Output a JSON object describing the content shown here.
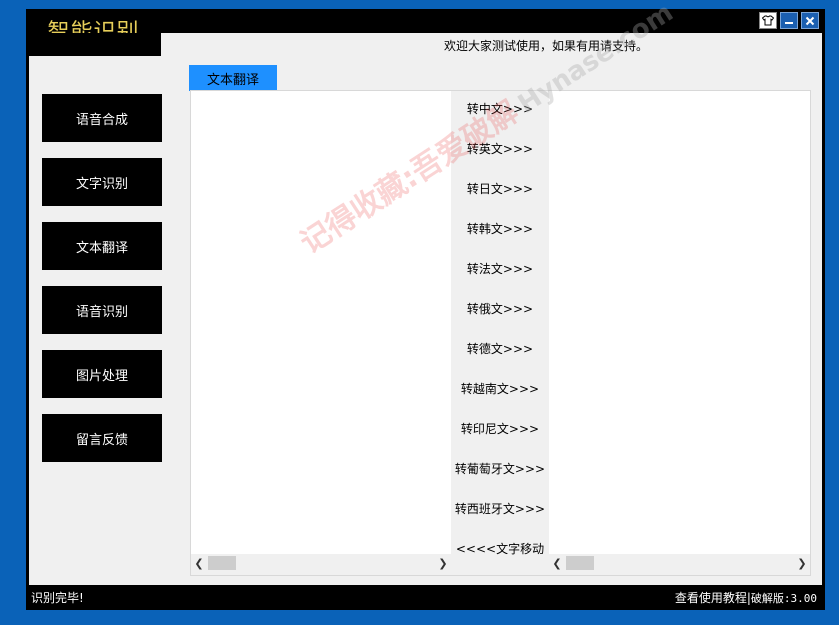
{
  "window": {
    "title": "智能识别",
    "banner": "欢迎大家测试使用，如果有用请支持。",
    "controls": {
      "skin_icon": "shirt-icon",
      "minimize_icon": "minimize-icon",
      "close_icon": "close-icon"
    }
  },
  "sidebar": {
    "items": [
      {
        "label": "语音合成"
      },
      {
        "label": "文字识别"
      },
      {
        "label": "文本翻译"
      },
      {
        "label": "语音识别"
      },
      {
        "label": "图片处理"
      },
      {
        "label": "留言反馈"
      }
    ]
  },
  "tab": {
    "label": "文本翻译"
  },
  "translate": {
    "buttons": [
      "转中文>>>",
      "转英文>>>",
      "转日文>>>",
      "转韩文>>>",
      "转法文>>>",
      "转俄文>>>",
      "转德文>>>",
      "转越南文>>>",
      "转印尼文>>>",
      "转葡萄牙文>>>",
      "转西班牙文>>>",
      "<<<<文字移动"
    ],
    "source_text": "",
    "target_text": ""
  },
  "watermark": {
    "text": "记得收藏:吾爱破解",
    "site": "Hynase.com"
  },
  "status": {
    "left": "识别完毕!",
    "tutorial_link": "查看使用教程",
    "separator": "|",
    "version": "破解版:3.00"
  },
  "colors": {
    "accent": "#1e90ff",
    "desktop": "#0a62b8",
    "title_gold": "#e7cf5a"
  }
}
